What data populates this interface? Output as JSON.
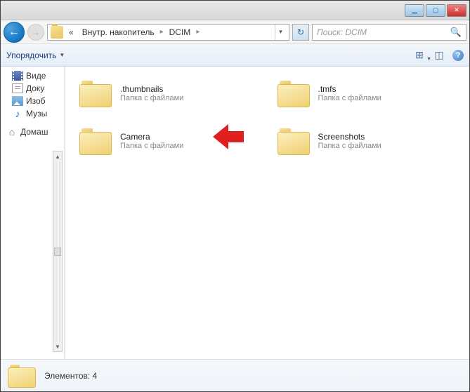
{
  "titlebar": {},
  "nav": {
    "breadcrumb_prefix": "«",
    "breadcrumb_parent": "Внутр. накопитель",
    "breadcrumb_current": "DCIM"
  },
  "search": {
    "placeholder": "Поиск: DCIM"
  },
  "toolbar": {
    "organize_label": "Упорядочить"
  },
  "sidebar": {
    "items": [
      {
        "label": "Виде",
        "icon": "video"
      },
      {
        "label": "Доку",
        "icon": "doc"
      },
      {
        "label": "Изоб",
        "icon": "img"
      },
      {
        "label": "Музы",
        "icon": "music"
      }
    ],
    "group_label": "Домаш",
    "group_icon": "home"
  },
  "content": {
    "folder_type_label": "Папка с файлами",
    "items": [
      {
        "name": ".thumbnails"
      },
      {
        "name": ".tmfs"
      },
      {
        "name": "Camera"
      },
      {
        "name": "Screenshots"
      }
    ]
  },
  "statusbar": {
    "elements_label": "Элементов: 4"
  }
}
